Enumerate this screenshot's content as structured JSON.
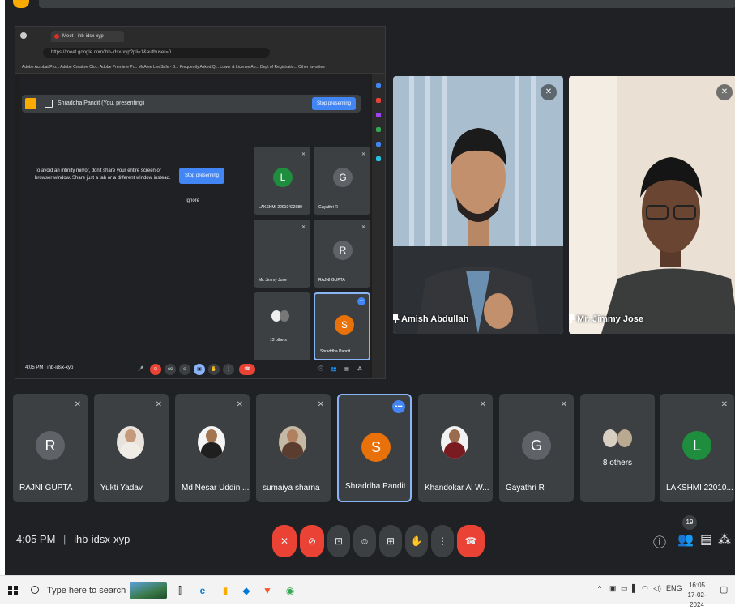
{
  "browser": {
    "tab_title": "Meet - ihb-idsx-xyp",
    "url": "https://meet.google.com/ihb-idsx-xyp?pli=1&authuser=0",
    "bookmarks": "Adobe Acrobat Pro...  Adobe Creative Clo...  Adobe Premiere Pr...  McAfee LiveSafe - B...  Frequently Asked Q...  Lower & License Ap...  Dept of Registratio...   Other favorites"
  },
  "inner_meet": {
    "presenting_label": "Shraddha Pandit (You, presenting)",
    "stop_presenting": "Stop presenting",
    "warning": "To avoid an infinity mirror, don't share your entire screen or browser window. Share just a tab or a different window instead.",
    "warning_stop": "Stop presenting",
    "ignore": "Ignore",
    "time": "4:05 PM",
    "meeting_code": "ihb-idsx-xyp",
    "tiles": [
      {
        "initial": "L",
        "name": "LAKSHMI 22010422080",
        "color": "#1e8e3e"
      },
      {
        "initial": "G",
        "name": "Gayathri R",
        "color": "#5f6368"
      },
      {
        "initial": "",
        "name": "Mr. Jimmy Jose",
        "color": ""
      },
      {
        "initial": "R",
        "name": "RAJNI GUPTA",
        "color": "#5f6368"
      },
      {
        "initial": "",
        "name": "13 others",
        "color": ""
      },
      {
        "initial": "S",
        "name": "Shraddha Pandit",
        "color": "#e8710a"
      }
    ]
  },
  "videos": [
    {
      "name": "Amish Abdullah"
    },
    {
      "name": "Mr. Jimmy Jose"
    }
  ],
  "participants": [
    {
      "name": "RAJNI GUPTA",
      "initial": "R",
      "color": "#5f6368",
      "type": "initial"
    },
    {
      "name": "Yukti Yadav",
      "initial": "",
      "color": "",
      "type": "photo"
    },
    {
      "name": "Md Nesar Uddin ...",
      "initial": "",
      "color": "",
      "type": "photo"
    },
    {
      "name": "sumaiya sharna",
      "initial": "",
      "color": "",
      "type": "photo"
    },
    {
      "name": "Shraddha Pandit",
      "initial": "S",
      "color": "#e8710a",
      "type": "initial"
    },
    {
      "name": "Khandokar Al W...",
      "initial": "",
      "color": "",
      "type": "photo"
    },
    {
      "name": "Gayathri R",
      "initial": "G",
      "color": "#5f6368",
      "type": "initial"
    },
    {
      "name": "8 others",
      "initial": "",
      "color": "",
      "type": "others"
    },
    {
      "name": "LAKSHMI 22010...",
      "initial": "L",
      "color": "#1e8e3e",
      "type": "initial"
    }
  ],
  "controls": {
    "time": "4:05 PM",
    "separator": "|",
    "meeting_code": "ihb-idsx-xyp",
    "participant_count": "19"
  },
  "taskbar": {
    "search_placeholder": "Type here to search",
    "language": "ENG",
    "time": "16:05",
    "date": "17-02-2024"
  },
  "colors": {
    "meet_bg": "#202124",
    "tile_bg": "#3c4043",
    "accent_blue": "#8ab4f8",
    "end_red": "#ea4335"
  }
}
